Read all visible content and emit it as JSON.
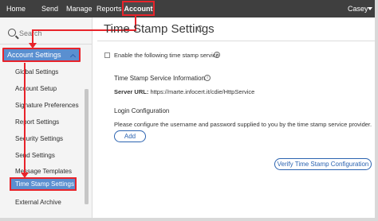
{
  "topnav": {
    "home": "Home",
    "send": "Send",
    "manage": "Manage",
    "reports": "Reports",
    "account": "Account",
    "user": "Casey"
  },
  "sidebar": {
    "search_placeholder": "Search",
    "section_label": "Account Settings",
    "items": [
      {
        "label": "Global Settings"
      },
      {
        "label": "Account Setup"
      },
      {
        "label": "Signature Preferences"
      },
      {
        "label": "Report Settings"
      },
      {
        "label": "Security Settings"
      },
      {
        "label": "Send Settings"
      },
      {
        "label": "Message Templates"
      },
      {
        "label": "Time Stamp Settings"
      },
      {
        "label": "External Archive"
      }
    ],
    "active_index": 7
  },
  "main": {
    "title": "Time Stamp Settings",
    "enable_label": "Enable the following time stamp service",
    "enable_checked": false,
    "service_title": "Time Stamp Service Information",
    "server_url_label": "Server URL:",
    "server_url_value": "https://marte.infocert.it/cdie/HttpService",
    "login_title": "Login Configuration",
    "login_desc": "Please configure the username and password supplied to you by the time stamp service provider.",
    "add_label": "Add",
    "verify_label": "Verify Time Stamp Configuration"
  },
  "colors": {
    "topbar": "#3f3f3f",
    "highlight": "#5a8fd0",
    "annotation": "#e8232a",
    "link_blue": "#2b63b0"
  }
}
